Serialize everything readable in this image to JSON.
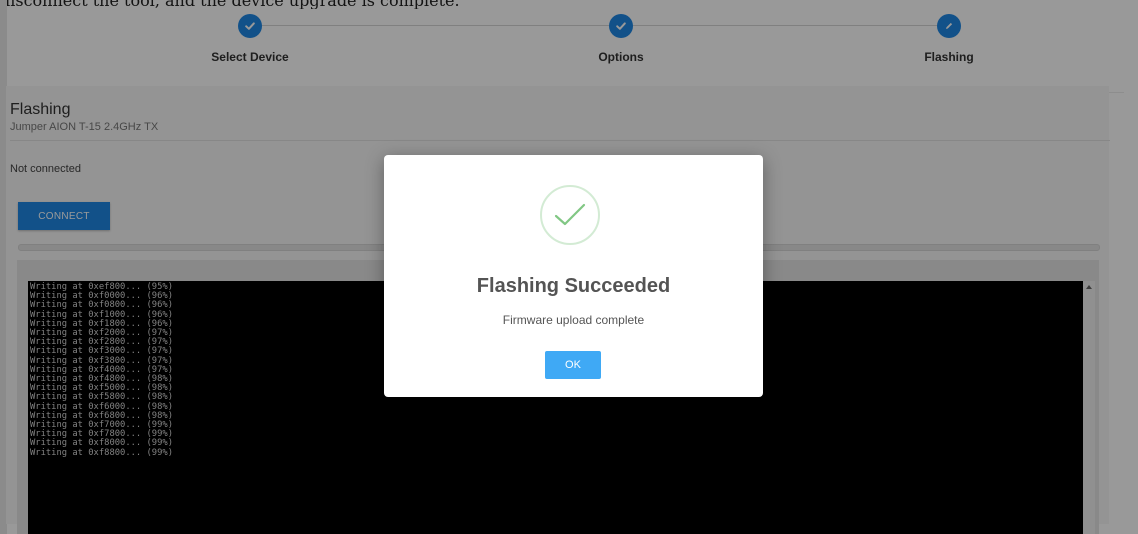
{
  "top_banner_text": "disconnect the tool, and the device upgrade is complete.",
  "stepper": {
    "steps": [
      {
        "label": "Select Device",
        "state": "done",
        "icon": "check-icon"
      },
      {
        "label": "Options",
        "state": "done",
        "icon": "check-icon"
      },
      {
        "label": "Flashing",
        "state": "active",
        "icon": "pencil-icon"
      }
    ]
  },
  "flashing": {
    "title": "Flashing",
    "device": "Jumper AION T-15 2.4GHz TX",
    "status": "Not connected",
    "connect_label": "CONNECT"
  },
  "console": {
    "lines": [
      "Writing at 0xef800... (95%)",
      "Writing at 0xf0000... (96%)",
      "Writing at 0xf0800... (96%)",
      "Writing at 0xf1000... (96%)",
      "Writing at 0xf1800... (96%)",
      "Writing at 0xf2000... (97%)",
      "Writing at 0xf2800... (97%)",
      "Writing at 0xf3000... (97%)",
      "Writing at 0xf3800... (97%)",
      "Writing at 0xf4000... (97%)",
      "Writing at 0xf4800... (98%)",
      "Writing at 0xf5000... (98%)",
      "Writing at 0xf5800... (98%)",
      "Writing at 0xf6000... (98%)",
      "Writing at 0xf6800... (98%)",
      "Writing at 0xf7000... (99%)",
      "Writing at 0xf7800... (99%)",
      "Writing at 0xf8000... (99%)",
      "Writing at 0xf8800... (99%)"
    ]
  },
  "modal": {
    "title": "Flashing Succeeded",
    "message": "Firmware upload complete",
    "ok_label": "OK",
    "icon": "success-check-icon"
  },
  "colors": {
    "accent": "#1e88e5",
    "ok_button": "#3fa9f5",
    "success": "#81c784",
    "console_bg": "#000000"
  }
}
